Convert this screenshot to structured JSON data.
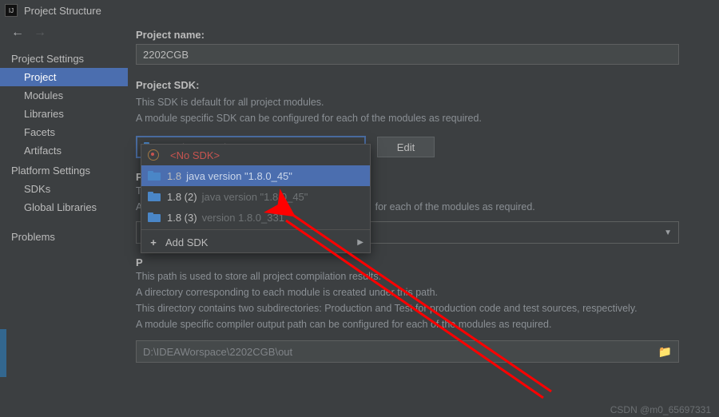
{
  "window": {
    "title": "Project Structure"
  },
  "sidebar": {
    "projectSettings": "Project Settings",
    "platformSettings": "Platform Settings",
    "items": {
      "project": "Project",
      "modules": "Modules",
      "libraries": "Libraries",
      "facets": "Facets",
      "artifacts": "Artifacts",
      "sdks": "SDKs",
      "globalLibs": "Global Libraries",
      "problems": "Problems"
    }
  },
  "content": {
    "projectNameLabel": "Project name:",
    "projectName": "2202CGB",
    "projectSdkLabel": "Project SDK:",
    "sdkDesc1": "This SDK is default for all project modules.",
    "sdkDesc2": "A module specific SDK can be configured for each of the modules as required.",
    "sdkSelected": {
      "name": "1.8",
      "version": "java version \"1.8.0_45\""
    },
    "editLabel": "Edit",
    "langLevelLabelP": "P",
    "langLevelDesc1T": "T",
    "langLevelDesc2A": "A",
    "langRightTail": "for each of the modules as required.",
    "outHeaderP": "P",
    "outDesc1": "This path is used to store all project compilation results.",
    "outDesc2": "A directory corresponding to each module is created under this path.",
    "outDesc3": "This directory contains two subdirectories: Production and Test for production code and test sources, respectively.",
    "outDesc4": "A module specific compiler output path can be configured for each of the modules as required.",
    "outPath": "D:\\IDEAWorspace\\2202CGB\\out"
  },
  "dropdown": {
    "noSdk": "<No SDK>",
    "opt1": {
      "name": "1.8",
      "version": "java version \"1.8.0_45\""
    },
    "opt2": {
      "name": "1.8 (2)",
      "version": "java version \"1.8.0_45\""
    },
    "opt3": {
      "name": "1.8 (3)",
      "version": "version 1.8.0_331"
    },
    "addSdk": "Add SDK"
  },
  "footer": {
    "credit": "CSDN @m0_65697331"
  }
}
